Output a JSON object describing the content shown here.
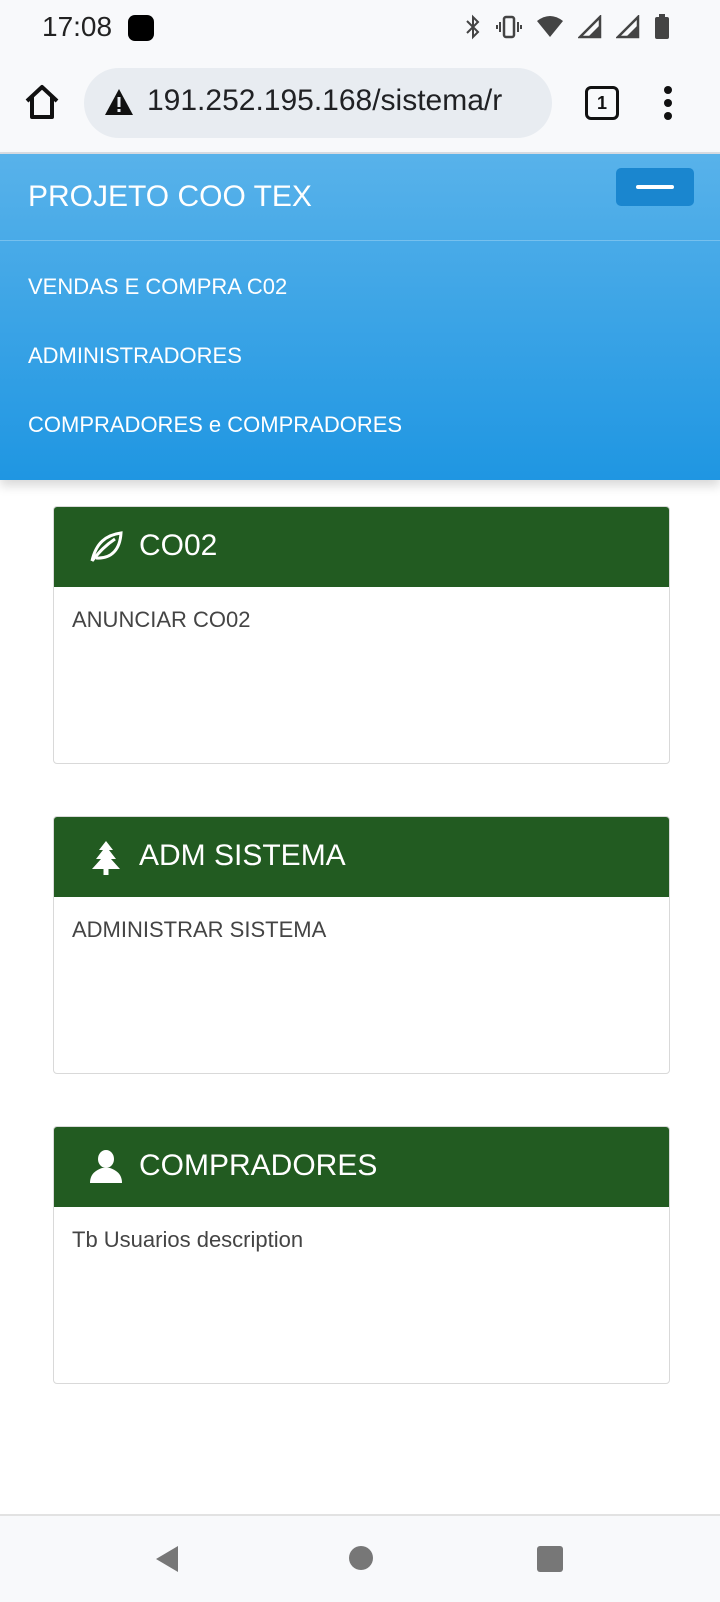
{
  "status_bar": {
    "time": "17:08",
    "icons": [
      "bluetooth-icon",
      "vibrate-icon",
      "wifi-icon",
      "signal-icon",
      "signal-icon",
      "battery-icon"
    ]
  },
  "browser": {
    "url": "191.252.195.168/sistema/r",
    "tab_count": "1"
  },
  "navbar": {
    "brand": "PROJETO COO TEX",
    "items": [
      {
        "label": "VENDAS E COMPRA C02"
      },
      {
        "label": "ADMINISTRADORES"
      },
      {
        "label": "COMPRADORES e COMPRADORES"
      }
    ]
  },
  "cards": [
    {
      "icon": "leaf-icon",
      "title": "CO02",
      "description": "ANUNCIAR CO02"
    },
    {
      "icon": "tree-icon",
      "title": "ADM SISTEMA",
      "description": "ADMINISTRAR SISTEMA"
    },
    {
      "icon": "user-icon",
      "title": "COMPRADORES",
      "description": "Tb Usuarios description"
    }
  ],
  "colors": {
    "navbar_top": "#58b2ea",
    "navbar_bottom": "#1f96e2",
    "card_header": "#225b21"
  }
}
